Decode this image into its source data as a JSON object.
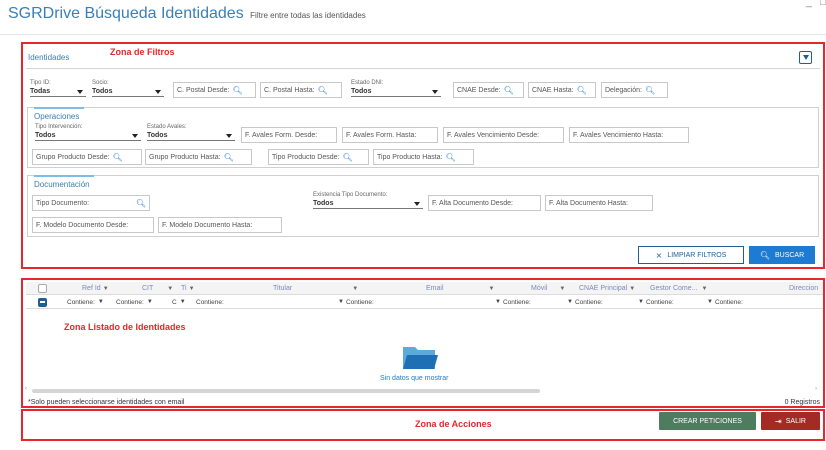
{
  "header": {
    "title": "SGRDrive Búsqueda Identidades",
    "subtitle": "Filtre entre todas las identidades",
    "window_minimize": "_",
    "window_edge": "□"
  },
  "zones": {
    "filters": "Zona de Filtros",
    "list": "Zona Listado de Identidades",
    "actions": "Zona de Acciones"
  },
  "filters": {
    "panel_title": "Identidades",
    "top_row": {
      "tipo_id": {
        "label": "Tipo ID:",
        "value": "Todas"
      },
      "socio": {
        "label": "Socio:",
        "value": "Todos"
      },
      "cp_desde": "C. Postal Desde:",
      "cp_hasta": "C. Postal Hasta:",
      "estado_dni": {
        "label": "Estado DNI:",
        "value": "Todos"
      },
      "cnae_desde": "CNAE Desde:",
      "cnae_hasta": "CNAE Hasta:",
      "delegacion": "Delegación:"
    },
    "operaciones": {
      "title": "Operaciones",
      "tipo_intervencion": {
        "label": "Tipo Intervención:",
        "value": "Todos"
      },
      "estado_avales": {
        "label": "Estado Avales:",
        "value": "Todos"
      },
      "f_avales_form_desde": "F. Avales Form. Desde:",
      "f_avales_form_hasta": "F. Avales Form. Hasta:",
      "f_avales_venc_desde": "F. Avales Vencimiento Desde:",
      "f_avales_venc_hasta": "F. Avales Vencimiento Hasta:",
      "grupo_producto_desde": "Grupo Producto Desde:",
      "grupo_producto_hasta": "Grupo Producto Hasta:",
      "tipo_producto_desde": "Tipo Producto Desde:",
      "tipo_producto_hasta": "Tipo Producto Hasta:"
    },
    "documentacion": {
      "title": "Documentación",
      "tipo_documento": "Tipo Documento:",
      "existencia_tipo_doc": {
        "label": "Existencia Tipo Documento:",
        "value": "Todos"
      },
      "f_alta_doc_desde": "F. Alta Documento Desde:",
      "f_alta_doc_hasta": "F. Alta Documento Hasta:",
      "f_modelo_doc_desde": "F. Modelo Documento Desde:",
      "f_modelo_doc_hasta": "F. Modelo Documento Hasta:"
    },
    "clear_button": "LIMPIAR FILTROS",
    "search_button": "BUSCAR"
  },
  "grid": {
    "columns": [
      "Ref Id",
      "CIT",
      "Ti",
      "Titular",
      "Email",
      "Móvil",
      "CNAE Principal",
      "Gestor Come...",
      "Direccion"
    ],
    "filter_cells": [
      "Contiene:",
      "Contiene:",
      "C",
      "Contiene:",
      "Contiene:",
      "Contiene:",
      "Contiene:",
      "Contiene:",
      "Contiene:"
    ],
    "empty_message": "Sin datos que mostrar",
    "footer_note": "*Solo pueden seleccionarse identidades con email",
    "record_count": "0 Registros"
  },
  "actions": {
    "create_button": "CREAR PETICIONES",
    "exit_button": "SALIR"
  },
  "colors": {
    "accent": "#1e7bd4",
    "zone_border": "#e8262c",
    "create_button": "#4e7c5f",
    "exit_button": "#a52a25"
  }
}
